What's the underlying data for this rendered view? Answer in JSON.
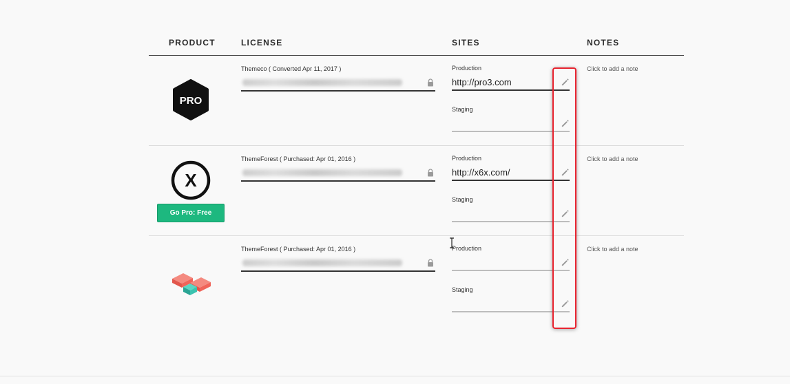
{
  "headers": {
    "product": "PRODUCT",
    "license": "LICENSE",
    "sites": "SITES",
    "notes": "NOTES"
  },
  "rows": [
    {
      "product": {
        "logo": "pro-hexagon-logo",
        "logo_text": "PRO"
      },
      "license": {
        "source": "Themeco ( Converted Apr 11, 2017 )"
      },
      "sites": {
        "production_label": "Production",
        "production_value": "http://pro3.com",
        "staging_label": "Staging",
        "staging_value": ""
      },
      "note": "Click to add a note"
    },
    {
      "product": {
        "logo": "x-circle-logo",
        "logo_text": "X",
        "button_label": "Go Pro: Free"
      },
      "license": {
        "source": "ThemeForest ( Purchased: Apr 01, 2016 )"
      },
      "sites": {
        "production_label": "Production",
        "production_value": "http://x6x.com/",
        "staging_label": "Staging",
        "staging_value": ""
      },
      "note": "Click to add a note"
    },
    {
      "product": {
        "logo": "blocks-logo"
      },
      "license": {
        "source": "ThemeForest ( Purchased: Apr 01, 2016 )"
      },
      "sites": {
        "production_label": "Production",
        "production_value": "",
        "staging_label": "Staging",
        "staging_value": ""
      },
      "note": "Click to add a note"
    }
  ],
  "colors": {
    "accent_green": "#1db87f",
    "highlight_red": "#e8232f",
    "logo_red": "#f0645a",
    "logo_teal": "#3cc3b0"
  }
}
